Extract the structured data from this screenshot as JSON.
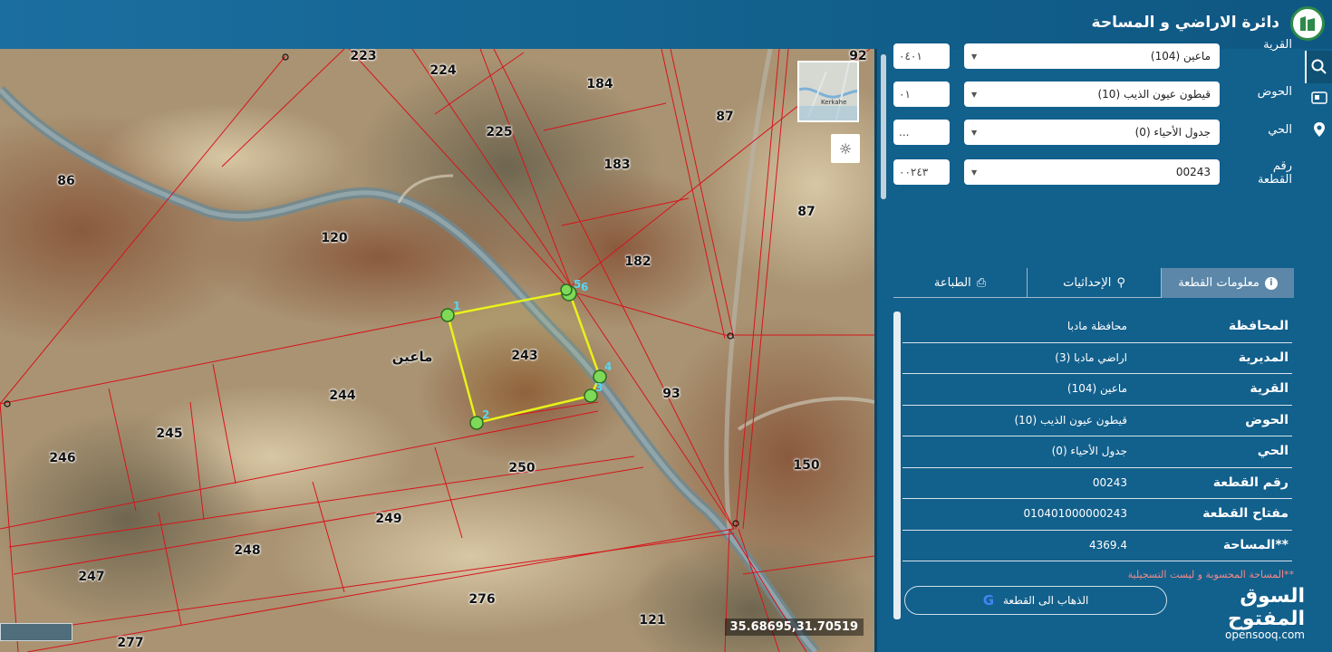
{
  "header": {
    "title": "دائرة الاراضي و المساحة",
    "logo_icon": "land-dept-logo"
  },
  "map": {
    "parcel_numbers": [
      {
        "id": "223",
        "label": "223"
      },
      {
        "id": "224",
        "label": "224"
      },
      {
        "id": "184",
        "label": "184"
      },
      {
        "id": "92",
        "label": "92"
      },
      {
        "id": "225",
        "label": "225"
      },
      {
        "id": "87a",
        "label": "87"
      },
      {
        "id": "86",
        "label": "86"
      },
      {
        "id": "183",
        "label": "183"
      },
      {
        "id": "87b",
        "label": "87"
      },
      {
        "id": "120",
        "label": "120"
      },
      {
        "id": "182",
        "label": "182"
      },
      {
        "id": "243",
        "label": "243"
      },
      {
        "id": "244",
        "label": "244"
      },
      {
        "id": "93",
        "label": "93"
      },
      {
        "id": "245",
        "label": "245"
      },
      {
        "id": "246",
        "label": "246"
      },
      {
        "id": "250",
        "label": "250"
      },
      {
        "id": "150",
        "label": "150"
      },
      {
        "id": "249",
        "label": "249"
      },
      {
        "id": "248",
        "label": "248"
      },
      {
        "id": "247",
        "label": "247"
      },
      {
        "id": "276",
        "label": "276"
      },
      {
        "id": "121",
        "label": "121"
      },
      {
        "id": "277",
        "label": "277"
      }
    ],
    "place_name": "ماعين",
    "vertex_labels": [
      "1",
      "2",
      "3",
      "4",
      "5",
      "6"
    ],
    "coordinates": "35.68695,31.70519",
    "thumbnail_label": "Kerkahe",
    "sun_icon": "sun-icon",
    "highlight_color": "#e8f21a",
    "boundary_color": "#d8131b"
  },
  "search": {
    "village": {
      "label": "القرية",
      "code": "٠٤٠١",
      "value": "ماعين (104)"
    },
    "basin": {
      "label": "الحوض",
      "code": "٠١",
      "value": "قيطون عيون الذيب (10)"
    },
    "neighborhood": {
      "label": "الحي",
      "code": "...",
      "value": "جدول الأحياء (0)"
    },
    "parcel": {
      "label_line1": "رقم",
      "label_line2": "القطعة",
      "code": "٠٠٢٤٣",
      "value": "00243"
    }
  },
  "tabs": [
    {
      "label": "معلومات القطعة",
      "icon": "info-icon"
    },
    {
      "label": "الإحداثيات",
      "icon": "person-pin-icon"
    },
    {
      "label": "الطباعة",
      "icon": "printer-icon"
    }
  ],
  "parcel_info": [
    {
      "key": "المحافظة",
      "value": "محافظة مادبا"
    },
    {
      "key": "المديرية",
      "value": "اراضي مادبا (3)"
    },
    {
      "key": "القرية",
      "value": "ماعين (104)"
    },
    {
      "key": "الحوض",
      "value": "قيطون عيون الذيب (10)"
    },
    {
      "key": "الحي",
      "value": "جدول الأحياء (0)"
    },
    {
      "key": "رقم القطعة",
      "value": "00243"
    },
    {
      "key": "مفتاح القطعة",
      "value": "010401000000243"
    },
    {
      "key": "**المساحة",
      "value": "4369.4"
    }
  ],
  "note": "**المساحة المحسوبة و ليست التسجيلية",
  "goto_button": "الذهاب الى القطعة",
  "watermark": {
    "arabic": "السوق المفتوح",
    "english": "opensooq.com"
  },
  "rail_icons": [
    "search-icon",
    "id-card-icon",
    "location-pin-icon"
  ]
}
